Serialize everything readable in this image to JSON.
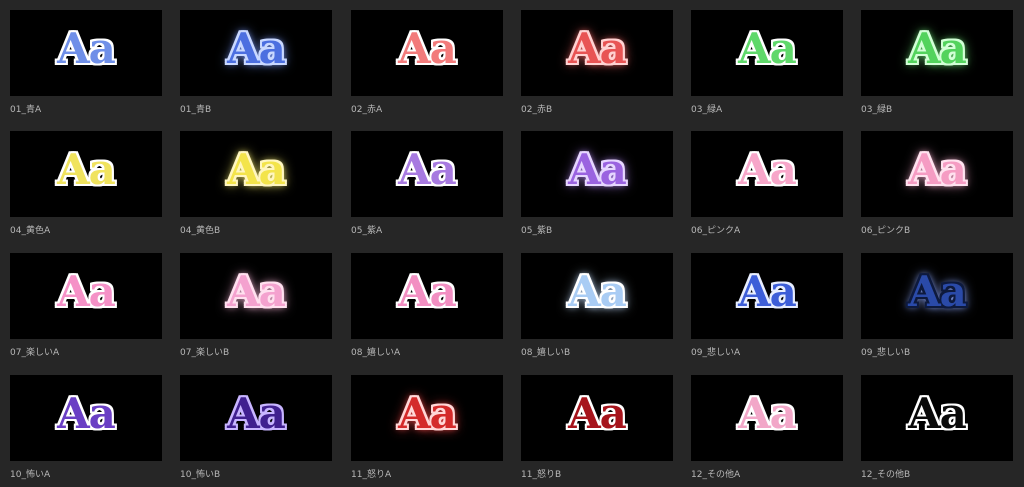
{
  "sample_text": "Aa",
  "thumbnails": [
    {
      "label": "01_青A",
      "fill": "#6f8fe8",
      "outline": "#ffffff",
      "glow": ""
    },
    {
      "label": "01_青B",
      "fill": "#4c6fe0",
      "outline": "#c9d8ff",
      "glow": "#7c9cff"
    },
    {
      "label": "02_赤A",
      "fill": "#f27b7b",
      "outline": "#ffffff",
      "glow": ""
    },
    {
      "label": "02_赤B",
      "fill": "#e85454",
      "outline": "#ffd2d2",
      "glow": "#ff6d6d"
    },
    {
      "label": "03_緑A",
      "fill": "#5fd86a",
      "outline": "#ffffff",
      "glow": ""
    },
    {
      "label": "03_緑B",
      "fill": "#53d35d",
      "outline": "#d2ffd6",
      "glow": "#6fe278"
    },
    {
      "label": "04_黄色A",
      "fill": "#f0e35e",
      "outline": "#ffffff",
      "glow": ""
    },
    {
      "label": "04_黄色B",
      "fill": "#f3e44b",
      "outline": "#fff6c0",
      "glow": "#f6ec6f"
    },
    {
      "label": "05_紫A",
      "fill": "#a77ae0",
      "outline": "#ffffff",
      "glow": ""
    },
    {
      "label": "05_紫B",
      "fill": "#9a63e0",
      "outline": "#e6d6ff",
      "glow": "#b48af0"
    },
    {
      "label": "06_ピンクA",
      "fill": "#f7a6c9",
      "outline": "#ffffff",
      "glow": ""
    },
    {
      "label": "06_ピンクB",
      "fill": "#f59cc3",
      "outline": "#ffe2ef",
      "glow": "#f7b0d0"
    },
    {
      "label": "07_楽しいA",
      "fill": "#f591c7",
      "outline": "#ffffff",
      "glow": ""
    },
    {
      "label": "07_楽しいB",
      "fill": "#f4a2cf",
      "outline": "#ffe0ef",
      "glow": "#f6b6d8"
    },
    {
      "label": "08_嬉しいA",
      "fill": "#f28fc2",
      "outline": "#ffffff",
      "glow": ""
    },
    {
      "label": "08_嬉しいB",
      "fill": "#a9ccf4",
      "outline": "#ffffff",
      "glow": "#c3dcfb"
    },
    {
      "label": "09_悲しいA",
      "fill": "#3d5ed8",
      "outline": "#e8eeff",
      "glow": ""
    },
    {
      "label": "09_悲しいB",
      "fill": "#2a4aa8",
      "outline": "#0e1a3d",
      "glow": "#8fa8ff"
    },
    {
      "label": "10_怖いA",
      "fill": "#6a3fc4",
      "outline": "#ffffff",
      "glow": ""
    },
    {
      "label": "10_怖いB",
      "fill": "#40208f",
      "outline": "#c8b5ff",
      "glow": ""
    },
    {
      "label": "11_怒りA",
      "fill": "#d42a2a",
      "outline": "#ffd7d7",
      "glow": "#ff4a4a"
    },
    {
      "label": "11_怒りB",
      "fill": "#a6141c",
      "outline": "#ffffff",
      "glow": ""
    },
    {
      "label": "12_その他A",
      "fill": "#f2a7c8",
      "outline": "#ffffff",
      "glow": ""
    },
    {
      "label": "12_その他B",
      "fill": "#0a0a0a",
      "outline": "#ffffff",
      "glow": ""
    }
  ]
}
